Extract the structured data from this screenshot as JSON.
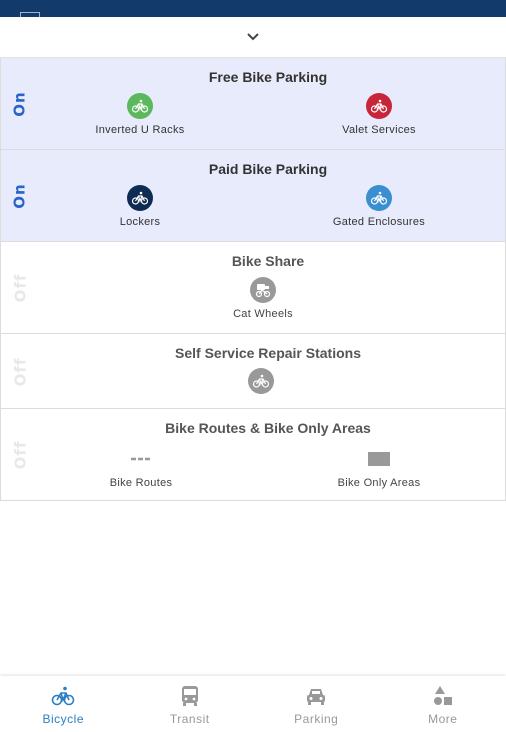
{
  "layers": [
    {
      "title": "Free Bike Parking",
      "state": "On",
      "items": [
        {
          "label": "Inverted U Racks",
          "icon": "bicycle-icon",
          "color": "#5cb85c"
        },
        {
          "label": "Valet Services",
          "icon": "bicycle-icon",
          "color": "#c9253a"
        }
      ]
    },
    {
      "title": "Paid Bike Parking",
      "state": "On",
      "items": [
        {
          "label": "Lockers",
          "icon": "bicycle-icon",
          "color": "#0e2b52"
        },
        {
          "label": "Gated Enclosures",
          "icon": "bicycle-icon",
          "color": "#3a8fd0"
        }
      ]
    },
    {
      "title": "Bike Share",
      "state": "Off",
      "items": [
        {
          "label": "Cat Wheels",
          "icon": "bike-share-icon",
          "color": "#999999"
        }
      ]
    },
    {
      "title": "Self Service Repair Stations",
      "state": "Off",
      "items": [
        {
          "label": "",
          "icon": "bicycle-icon",
          "color": "#999999"
        }
      ]
    },
    {
      "title": "Bike Routes & Bike Only Areas",
      "state": "Off",
      "items": [
        {
          "label": "Bike Routes",
          "icon": "dashed-line-icon",
          "color": "#999999"
        },
        {
          "label": "Bike Only Areas",
          "icon": "rectangle-area-icon",
          "color": "#999999"
        }
      ]
    }
  ],
  "nav": [
    {
      "label": "Bicycle",
      "icon": "bicycle-icon",
      "active": true
    },
    {
      "label": "Transit",
      "icon": "bus-icon",
      "active": false
    },
    {
      "label": "Parking",
      "icon": "car-icon",
      "active": false
    },
    {
      "label": "More",
      "icon": "shapes-icon",
      "active": false
    }
  ],
  "colors": {
    "accent": "#2a7fc4",
    "on_bg": "#e8ebfb",
    "topbar": "#123a6b"
  }
}
